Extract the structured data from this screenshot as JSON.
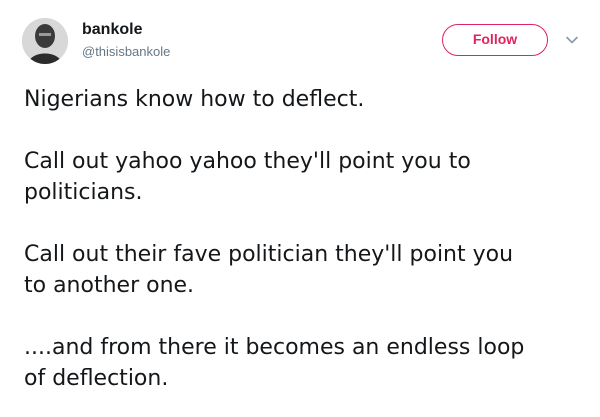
{
  "author": {
    "display_name": "bankole",
    "handle": "@thisisbankole",
    "avatar_icon": "user-avatar-photo"
  },
  "actions": {
    "follow_label": "Follow",
    "menu_icon": "chevron-down-icon"
  },
  "tweet": {
    "lines": [
      [
        "Nigerians know how to deflect."
      ],
      [
        "Call out yahoo yahoo they'll point you to",
        "politicians."
      ],
      [
        "Call out their fave politician they'll point you",
        "to another one."
      ],
      [
        "....and from there it becomes an endless loop",
        "of deflection."
      ]
    ]
  },
  "colors": {
    "follow_accent": "#e0245e",
    "text": "#14171a",
    "secondary_text": "#657786"
  }
}
